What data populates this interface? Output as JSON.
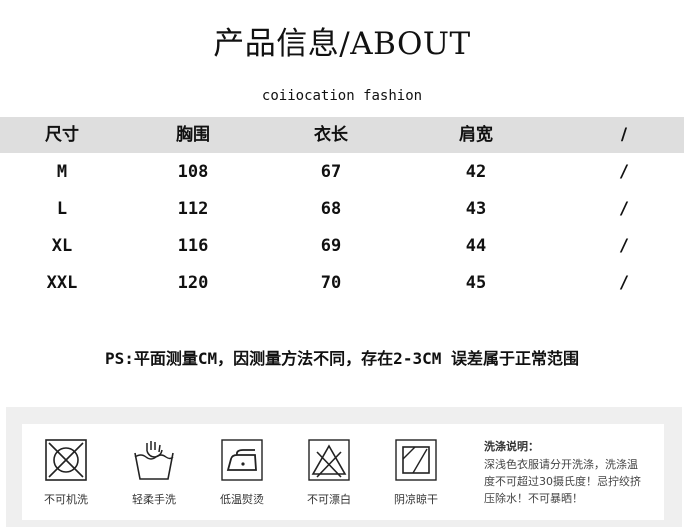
{
  "header": {
    "title": "产品信息/ABOUT",
    "subtitle": "coiiocation fashion"
  },
  "size_table": {
    "columns": [
      "尺寸",
      "胸围",
      "衣长",
      "肩宽",
      "/"
    ],
    "rows": [
      [
        "M",
        "108",
        "67",
        "42",
        "/"
      ],
      [
        "L",
        "112",
        "68",
        "43",
        "/"
      ],
      [
        "XL",
        "116",
        "69",
        "44",
        "/"
      ],
      [
        "XXL",
        "120",
        "70",
        "45",
        "/"
      ]
    ]
  },
  "note": "PS:平面测量CM，因测量方法不同，存在2-3CM 误差属于正常范围",
  "care": {
    "icons": [
      {
        "name": "no-machine-wash-icon",
        "label": "不可机洗"
      },
      {
        "name": "gentle-hand-wash-icon",
        "label": "轻柔手洗"
      },
      {
        "name": "low-temperature-iron-icon",
        "label": "低温熨烫"
      },
      {
        "name": "no-bleach-icon",
        "label": "不可漂白"
      },
      {
        "name": "shade-dry-icon",
        "label": "阴凉晾干"
      }
    ],
    "title": "洗涤说明：",
    "lines": [
      "深浅色衣服请分开洗涤，洗涤温",
      "度不可超过30摄氏度！忌拧绞挤",
      "压除水！不可暴晒！"
    ]
  }
}
